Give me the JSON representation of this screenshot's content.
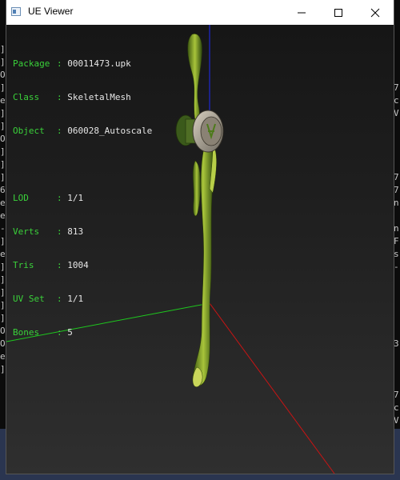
{
  "window": {
    "title": "UE Viewer"
  },
  "info": {
    "package_label": "Package",
    "package": "00011473.upk",
    "class_label": "Class",
    "class": "SkeletalMesh",
    "object_label": "Object",
    "object": "060028_Autoscale",
    "lod_label": "LOD",
    "lod": "1/1",
    "verts_label": "Verts",
    "verts": "813",
    "tris_label": "Tris",
    "tris": "1004",
    "uvset_label": "UV Set",
    "uvset": "1/1",
    "bones_label": "Bones",
    "bones": "5"
  },
  "console_left": [
    "]",
    "]",
    "O",
    "]",
    "e",
    "]",
    "]",
    "O",
    "]",
    "]",
    "]",
    "6",
    "e",
    "e",
    "-",
    "]",
    "e",
    "]",
    "]",
    "]",
    "]",
    "]",
    "O",
    "O",
    "e",
    "]"
  ],
  "console_right": [
    "7",
    "c",
    "V",
    "",
    "",
    "",
    "",
    "7",
    "7",
    "n",
    "",
    "n",
    "F",
    "s",
    "-",
    "",
    "",
    "",
    "",
    "",
    "3",
    "",
    "",
    "",
    "7",
    "c",
    "V"
  ],
  "colors": {
    "label": "#3ad13a",
    "value": "#e6e6e6",
    "axis_x": "#c81414",
    "axis_y": "#1ec81e",
    "axis_z": "#1e28d2",
    "mesh": "#6f8f1f"
  },
  "icons": [
    "app-window-icon",
    "minimize-icon",
    "maximize-icon",
    "close-icon"
  ]
}
